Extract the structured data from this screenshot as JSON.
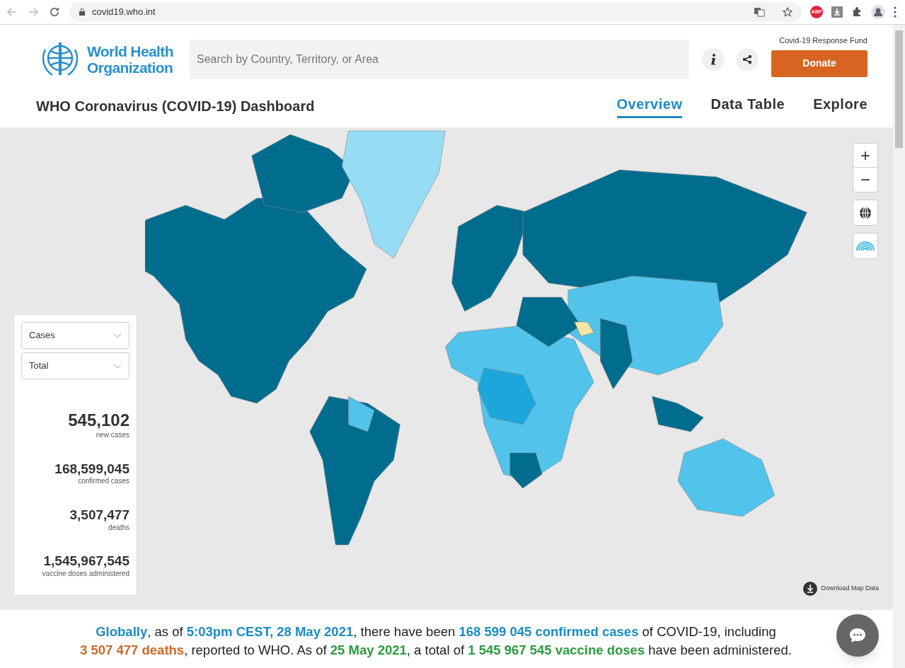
{
  "browser": {
    "url": "covid19.who.int",
    "extension_badge": "ABP"
  },
  "header": {
    "logo_lines": [
      "World Health",
      "Organization"
    ],
    "search": {
      "placeholder": "Search by Country, Territory, or Area"
    },
    "fund_label": "Covid-19 Response Fund",
    "donate": "Donate"
  },
  "title": "WHO Coronavirus (COVID-19) Dashboard",
  "nav": [
    {
      "label": "Overview",
      "selected": true
    },
    {
      "label": "Data Table",
      "selected": false
    },
    {
      "label": "Explore",
      "selected": false
    }
  ],
  "map_controls": {
    "zoom_in": "+",
    "zoom_out": "−"
  },
  "stats_panel": {
    "dropdowns": [
      "Cases",
      "Total"
    ],
    "stats": [
      {
        "value": "545,102",
        "label": "new cases"
      },
      {
        "value": "168,599,045",
        "label": "confirmed cases"
      },
      {
        "value": "3,507,477",
        "label": "deaths"
      },
      {
        "value": "1,545,967,545",
        "label": "vaccine doses administered"
      }
    ]
  },
  "download": "Download Map Data",
  "summary": [
    {
      "kind": "cases",
      "text": "Globally"
    },
    {
      "kind": "plain",
      "text": ", as of "
    },
    {
      "kind": "cases",
      "text": "5:03pm CEST, 28 May 2021"
    },
    {
      "kind": "plain",
      "text": ", there have been "
    },
    {
      "kind": "cases",
      "text": "168 599 045 confirmed cases"
    },
    {
      "kind": "plain",
      "text": " of COVID-19, including "
    },
    {
      "kind": "break"
    },
    {
      "kind": "deaths",
      "text": "3 507 477 deaths"
    },
    {
      "kind": "plain",
      "text": ", reported to WHO. As of "
    },
    {
      "kind": "vaccines",
      "text": "25 May 2021"
    },
    {
      "kind": "plain",
      "text": ", a total of "
    },
    {
      "kind": "vaccines",
      "text": "1 545 967 545 vaccine doses"
    },
    {
      "kind": "plain",
      "text": " have been administered."
    }
  ]
}
